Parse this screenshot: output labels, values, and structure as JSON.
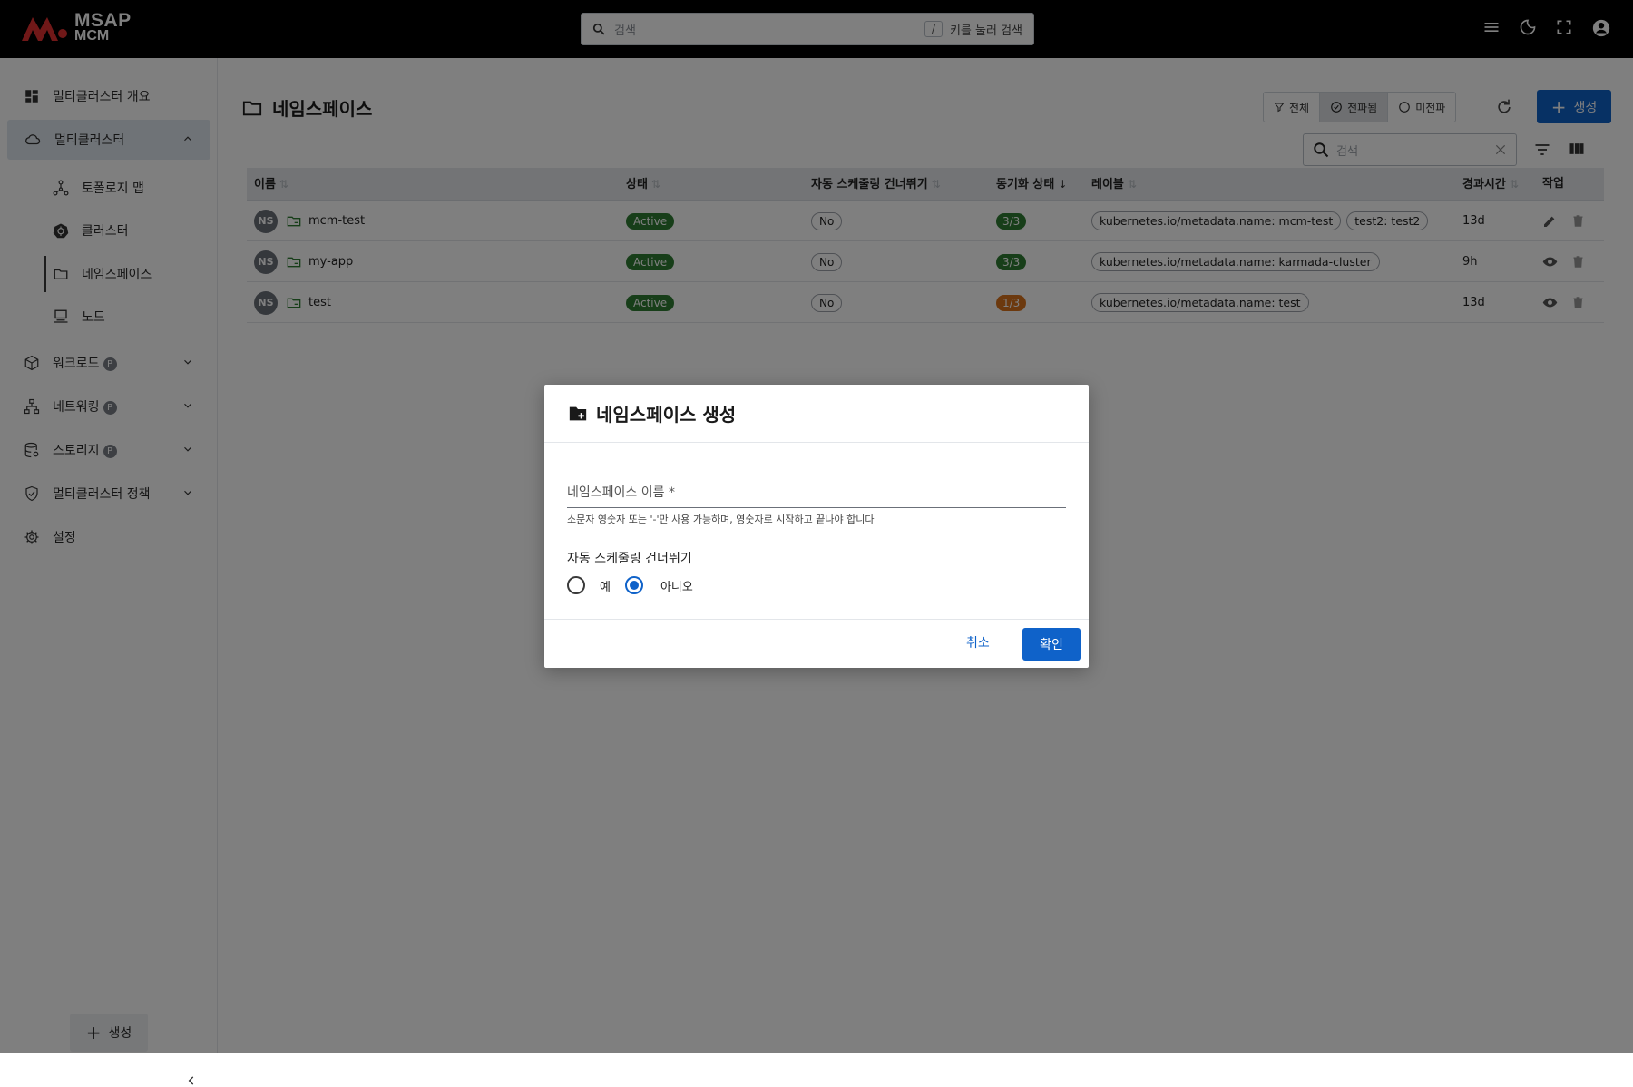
{
  "app": {
    "brand_line1": "MSAP",
    "brand_line2": "MCM"
  },
  "search": {
    "placeholder": "검색",
    "shortcut_key": "/",
    "shortcut_hint": "키를 눌러 검색"
  },
  "sidebar": {
    "items": [
      {
        "label": "멀티클러스터 개요",
        "icon": "dashboard-icon"
      },
      {
        "label": "멀티클러스터",
        "icon": "cloud-icon",
        "expanded": true
      },
      {
        "label": "워크로드",
        "icon": "cube-icon",
        "badge": "P"
      },
      {
        "label": "네트워킹",
        "icon": "network-icon",
        "badge": "P"
      },
      {
        "label": "스토리지",
        "icon": "database-icon",
        "badge": "P"
      },
      {
        "label": "멀티클러스터 정책",
        "icon": "shield-icon"
      },
      {
        "label": "설정",
        "icon": "gear-icon"
      }
    ],
    "sub_items": [
      {
        "label": "토폴로지 맵",
        "icon": "topology-icon"
      },
      {
        "label": "클러스터",
        "icon": "kubernetes-icon"
      },
      {
        "label": "네임스페이스",
        "icon": "folder-icon",
        "selected": true
      },
      {
        "label": "노드",
        "icon": "server-icon"
      }
    ],
    "create_label": "생성"
  },
  "page": {
    "title": "네임스페이스",
    "filters": [
      {
        "label": "전체",
        "icon": "filter-icon"
      },
      {
        "label": "전파됨",
        "icon": "check-circle-icon",
        "active": true
      },
      {
        "label": "미전파",
        "icon": "circle-icon"
      }
    ],
    "create_label": "생성",
    "table_search_placeholder": "검색"
  },
  "table": {
    "columns": [
      "이름",
      "상태",
      "자동 스케줄링 건너뛰기",
      "동기화 상태",
      "레이블",
      "경과시간",
      "작업"
    ],
    "rows": [
      {
        "avatar": "NS",
        "name": "mcm-test",
        "status": "Active",
        "skip": "No",
        "sync": "3/3",
        "sync_state": "ok",
        "labels": [
          "kubernetes.io/metadata.name: mcm-test",
          "test2: test2"
        ],
        "age": "13d",
        "action": "edit-icon"
      },
      {
        "avatar": "NS",
        "name": "my-app",
        "status": "Active",
        "skip": "No",
        "sync": "3/3",
        "sync_state": "ok",
        "labels": [
          "kubernetes.io/metadata.name: karmada-cluster"
        ],
        "age": "9h",
        "action": "eye-icon"
      },
      {
        "avatar": "NS",
        "name": "test",
        "status": "Active",
        "skip": "No",
        "sync": "1/3",
        "sync_state": "warn",
        "labels": [
          "kubernetes.io/metadata.name: test"
        ],
        "age": "13d",
        "action": "eye-icon"
      }
    ]
  },
  "dialog": {
    "title": "네임스페이스 생성",
    "name_label": "네임스페이스 이름 *",
    "name_value": "",
    "name_help": "소문자 영숫자 또는 '-'만 사용 가능하며, 영숫자로 시작하고 끝나야 합니다",
    "skip_label": "자동 스케줄링 건너뛰기",
    "options": [
      "예",
      "아니오"
    ],
    "selected_option": "아니오",
    "cancel_label": "취소",
    "confirm_label": "확인"
  },
  "colors": {
    "primary": "#0f62c9",
    "active_green": "#2e7d32",
    "warning_orange": "#d9731c",
    "topbar": "#000000"
  }
}
